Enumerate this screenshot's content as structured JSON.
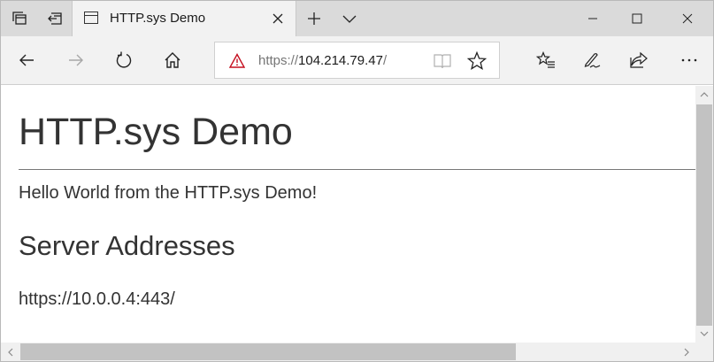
{
  "browser": {
    "tab": {
      "title": "HTTP.sys Demo"
    },
    "address_bar": {
      "url_prefix": "https://",
      "url_host": "104.214.79.47",
      "url_suffix": "/"
    },
    "icons": {
      "tab_manager": "tab-manager-icon",
      "set_aside": "set-aside-tabs-icon",
      "new_tab": "plus-icon",
      "tab_preview": "chevron-down-icon",
      "minimize": "minimize-icon",
      "maximize": "maximize-icon",
      "close": "close-icon",
      "back": "back-arrow-icon",
      "forward": "forward-arrow-icon",
      "refresh": "refresh-icon",
      "home": "home-icon",
      "security_warning": "warning-triangle-icon",
      "reading_view": "book-icon",
      "favorite": "star-icon",
      "favorites_hub": "favorites-list-icon",
      "notes": "pen-icon",
      "share": "share-icon",
      "more": "more-icon"
    }
  },
  "page": {
    "title": "HTTP.sys Demo",
    "greeting": "Hello World from the HTTP.sys Demo!",
    "server_addresses_heading": "Server Addresses",
    "server_addresses": [
      "https://10.0.0.4:443/"
    ]
  }
}
